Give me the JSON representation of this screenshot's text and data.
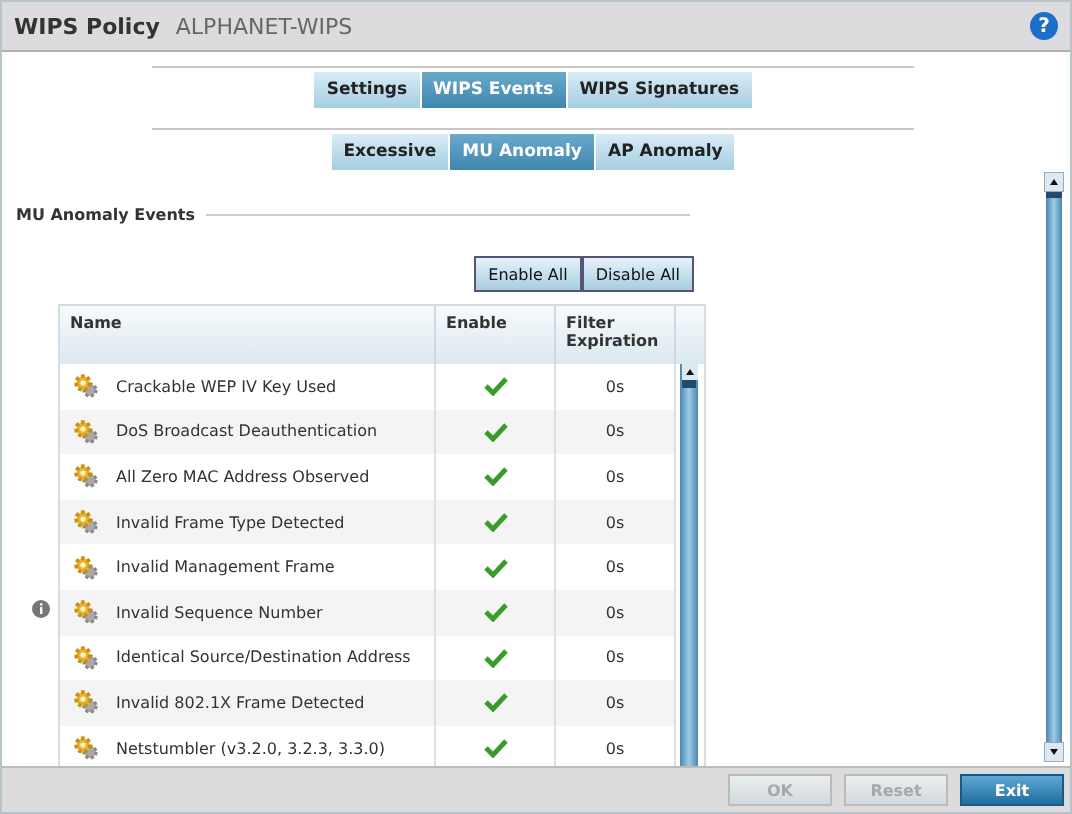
{
  "header": {
    "title": "WIPS Policy",
    "subtitle": "ALPHANET-WIPS",
    "help": "?"
  },
  "tabs": [
    {
      "label": "Settings",
      "selected": false
    },
    {
      "label": "WIPS Events",
      "selected": true
    },
    {
      "label": "WIPS Signatures",
      "selected": false
    }
  ],
  "subtabs": [
    {
      "label": "Excessive",
      "selected": false
    },
    {
      "label": "MU Anomaly",
      "selected": true
    },
    {
      "label": "AP Anomaly",
      "selected": false
    }
  ],
  "section": {
    "title": "MU Anomaly Events"
  },
  "actions": [
    "Enable All",
    "Disable All"
  ],
  "table": {
    "columns": [
      "Name",
      "Enable",
      "Filter Expiration"
    ],
    "rows": [
      {
        "name": "Crackable WEP IV Key Used",
        "enabled": true,
        "expiration": "0s",
        "info": false
      },
      {
        "name": "DoS Broadcast Deauthentication",
        "enabled": true,
        "expiration": "0s",
        "info": false
      },
      {
        "name": "All Zero MAC Address Observed",
        "enabled": true,
        "expiration": "0s",
        "info": false
      },
      {
        "name": "Invalid Frame Type Detected",
        "enabled": true,
        "expiration": "0s",
        "info": false
      },
      {
        "name": "Invalid Management Frame",
        "enabled": true,
        "expiration": "0s",
        "info": false
      },
      {
        "name": "Invalid Sequence Number",
        "enabled": true,
        "expiration": "0s",
        "info": true
      },
      {
        "name": "Identical Source/Destination Address",
        "enabled": true,
        "expiration": "0s",
        "info": false
      },
      {
        "name": "Invalid 802.1X Frame Detected",
        "enabled": true,
        "expiration": "0s",
        "info": false
      },
      {
        "name": "Netstumbler (v3.2.0, 3.2.3, 3.3.0)",
        "enabled": true,
        "expiration": "0s",
        "info": false
      }
    ]
  },
  "footer": [
    {
      "label": "OK",
      "disabled": true,
      "kind": "plain"
    },
    {
      "label": "Reset",
      "disabled": true,
      "kind": "plain"
    },
    {
      "label": "Exit",
      "disabled": false,
      "kind": "primary"
    }
  ]
}
